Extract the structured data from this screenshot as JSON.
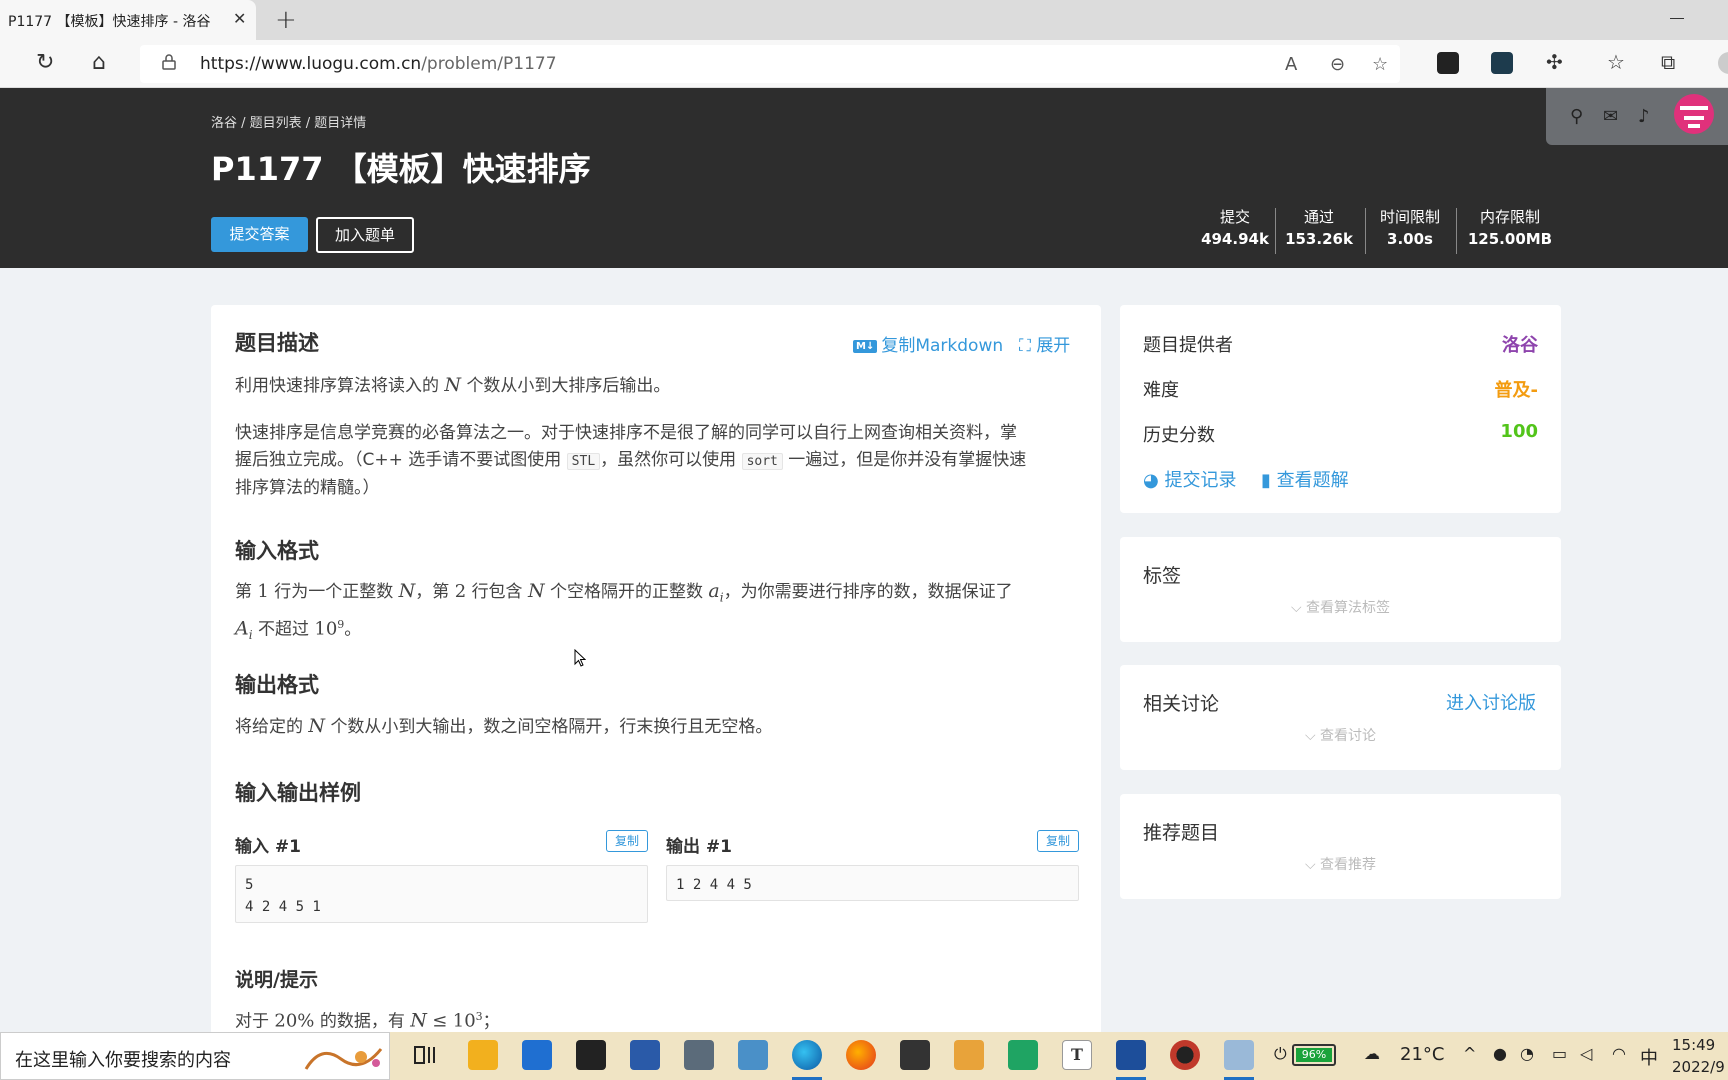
{
  "browser": {
    "tab_title": "P1177 【模板】快速排序 - 洛谷",
    "url_domain": "https://www.luogu.com.cn",
    "url_path": "/problem/P1177"
  },
  "header": {
    "breadcrumb": "洛谷 / 题目列表 / 题目详情",
    "title": "P1177 【模板】快速排序",
    "submit_label": "提交答案",
    "add_list_label": "加入题单",
    "stats": [
      {
        "label": "提交",
        "value": "494.94k"
      },
      {
        "label": "通过",
        "value": "153.26k"
      },
      {
        "label": "时间限制",
        "value": "3.00s"
      },
      {
        "label": "内存限制",
        "value": "125.00MB"
      }
    ]
  },
  "problem": {
    "description_heading": "题目描述",
    "copy_markdown": "复制Markdown",
    "md_badge": "M↓",
    "expand": "展开",
    "desc_p1_a": "利用快速排序算法将读入的",
    "desc_p1_b": "个数从小到大排序后输出。",
    "var_N": "N",
    "desc_p2_a": "快速排序是信息学竞赛的必备算法之一。对于快速排序不是很了解的同学可以自行上网查询相关资料，掌",
    "desc_p2_b": "握后独立完成。（C++ 选手请不要试图使用",
    "code_stl": "STL",
    "desc_p2_c": "，虽然你可以使用",
    "code_sort": "sort",
    "desc_p2_d": "一遍过，但是你并没有掌握快速",
    "desc_p2_e": "排序算法的精髓。）",
    "input_heading": "输入格式",
    "input_a": "第",
    "input_num1": "1",
    "input_b": "行为一个正整数",
    "input_c": "，第",
    "input_num2": "2",
    "input_d": "行包含",
    "input_e": "个空格隔开的正整数",
    "var_a": "a",
    "sub_i": "i",
    "input_f": "，为你需要进行排序的数，数据保证了",
    "var_A": "A",
    "input_g": "不超过",
    "num_10": "10",
    "sup_9": "9",
    "input_h": "。",
    "output_heading": "输出格式",
    "output_a": "将给定的",
    "output_b": "个数从小到大输出，数之间空格隔开，行末换行且无空格。",
    "sample_heading": "输入输出样例",
    "input_sample_label": "输入 #1",
    "output_sample_label": "输出 #1",
    "copy_label": "复制",
    "input_sample": "5\n4 2 4 5 1",
    "output_sample": "1 2 4 4 5",
    "hint_heading": "说明/提示",
    "hint_a": "对于",
    "hint_pct": "20%",
    "hint_b": "的数据，有",
    "hint_leq": "≤",
    "hint_sup3": "3",
    "hint_c": "；"
  },
  "sidebar": {
    "provider_label": "题目提供者",
    "provider_value": "洛谷",
    "difficulty_label": "难度",
    "difficulty_value": "普及-",
    "score_label": "历史分数",
    "score_value": "100",
    "records_link": "提交记录",
    "solutions_link": "查看题解",
    "tags_heading": "标签",
    "tags_more": "查看算法标签",
    "discussion_heading": "相关讨论",
    "discussion_link": "进入讨论版",
    "discussion_more": "查看讨论",
    "recommend_heading": "推荐题目",
    "recommend_more": "查看推荐"
  },
  "taskbar": {
    "search_placeholder": "在这里输入你要搜索的内容",
    "battery": "96%",
    "weather": "21°C",
    "ime": "中",
    "time": "15:49",
    "date": "2022/9"
  },
  "colors": {
    "accent": "#3498db",
    "provider": "#8e44ad",
    "difficulty": "#f39c11",
    "score": "#52c41a",
    "header_bg": "#2d2d2d"
  }
}
